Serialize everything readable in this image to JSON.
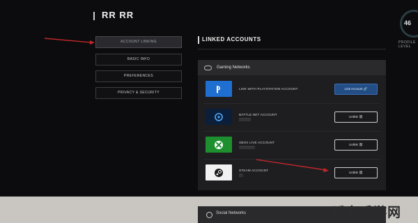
{
  "header": {
    "profile_name": "RR RR",
    "ring_value": "46",
    "ring_label": "PROFILE LEVEL"
  },
  "sidebar": {
    "items": [
      {
        "label": "ACCOUNT LINKING",
        "active": true
      },
      {
        "label": "BASIC INFO",
        "active": false
      },
      {
        "label": "PREFERENCES",
        "active": false
      },
      {
        "label": "PRIVACY & SECURITY",
        "active": false
      }
    ]
  },
  "main": {
    "section_title": "LINKED ACCOUNTS",
    "gaming_panel": {
      "title": "Gaming Networks",
      "rows": [
        {
          "name": "LINK WITH PLAYSTATION ACCOUNT",
          "sub": "",
          "button": "Link Account",
          "button_icon": "link-icon",
          "logo": "playstation-logo",
          "logo_color": "#1f6fd1"
        },
        {
          "name": "BATTLE.NET ACCOUNT",
          "sub": "",
          "button": "Unlink",
          "button_icon": "unlink-icon",
          "logo": "battlenet-logo",
          "logo_color": "#0b1f3a"
        },
        {
          "name": "XBOX LIVE ACCOUNT",
          "sub": "",
          "button": "Unlink",
          "button_icon": "unlink-icon",
          "logo": "xbox-logo",
          "logo_color": "#1e8f2e"
        },
        {
          "name": "STEAM ACCOUNT",
          "sub": "",
          "button": "Unlink",
          "button_icon": "unlink-icon",
          "logo": "steam-logo",
          "logo_color": "#f2f2f2"
        }
      ]
    },
    "social_panel": {
      "title": "Social Networks"
    }
  },
  "watermark": "睡安手游网",
  "colors": {
    "accent_blue": "#234d85",
    "annotation_red": "#c0282a"
  }
}
